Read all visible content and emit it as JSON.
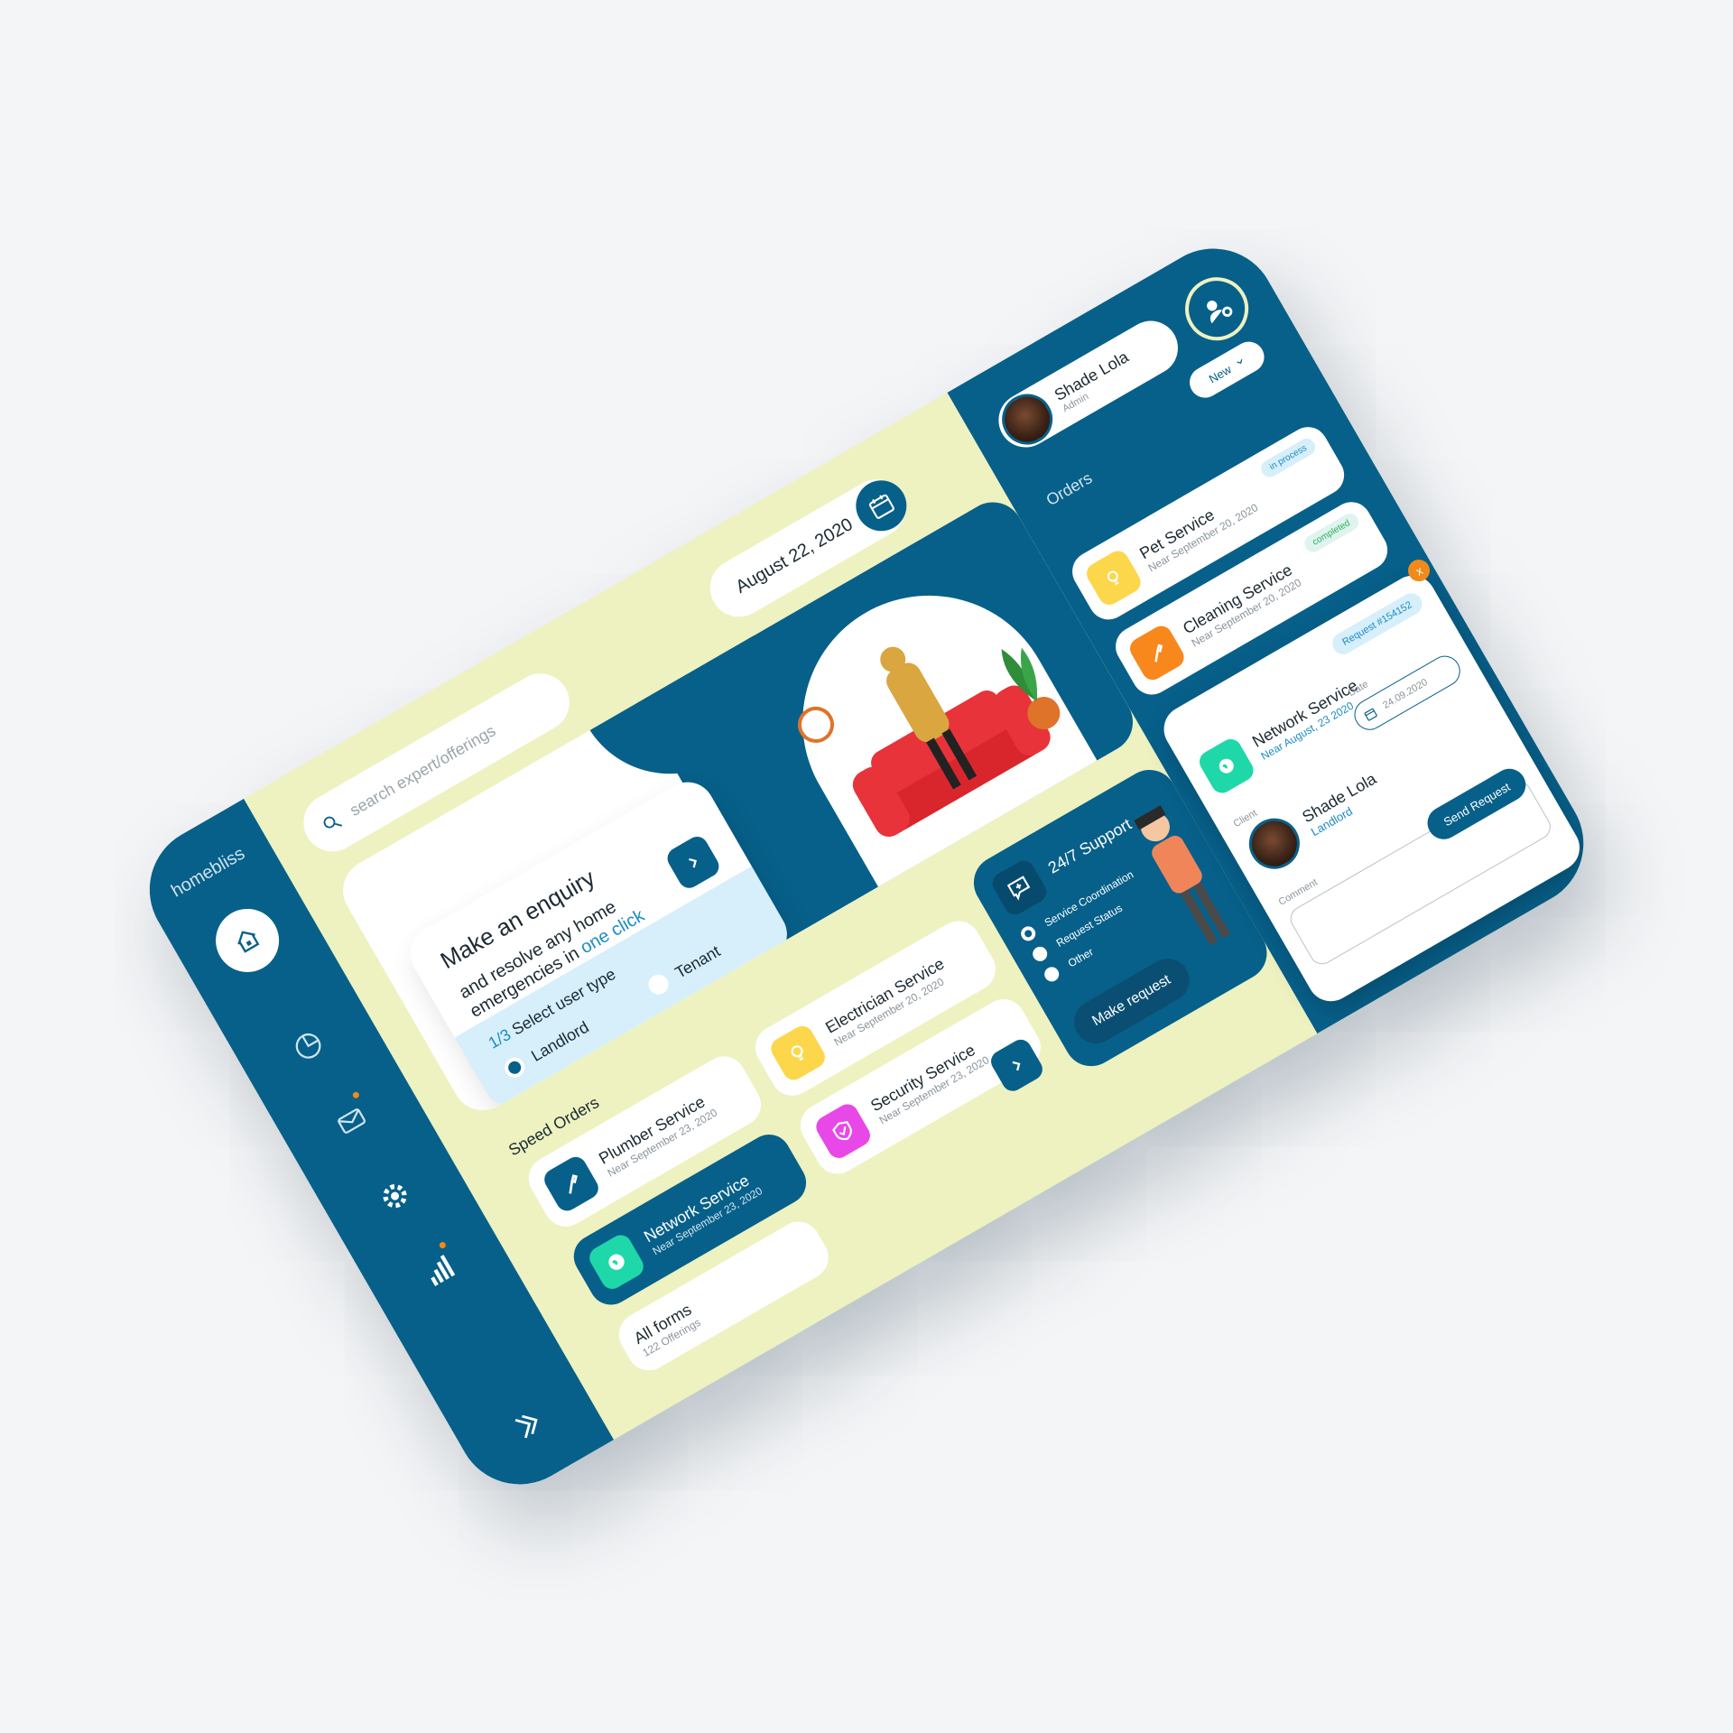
{
  "brand": "homebliss",
  "search": {
    "placeholder": "search expert/offerings"
  },
  "date": "August 22, 2020",
  "enquiry": {
    "title": "Make an enquiry",
    "line1": "and resolve any home",
    "line2_prefix": "emergencies in",
    "line2_highlight": "one click",
    "step_num": "1/3",
    "step_label": "Select user type",
    "options": [
      "Landlord",
      "Tenant"
    ]
  },
  "speed_orders": {
    "title": "Speed Orders",
    "items": [
      {
        "name": "Plumber Service",
        "sub": "Near September 23, 2020",
        "icon": "wrench-icon"
      },
      {
        "name": "Electrician Service",
        "sub": "Near September 20, 2020",
        "icon": "lightbulb-icon"
      },
      {
        "name": "Network Service",
        "sub": "Near September 23, 2020",
        "icon": "globe-icon"
      },
      {
        "name": "Security Service",
        "sub": "Near September 23, 2020",
        "icon": "shield-icon"
      }
    ],
    "all_forms": {
      "title": "All forms",
      "sub": "122 Offerings"
    }
  },
  "support": {
    "title": "24/7 Support",
    "options": [
      "Service Coordination",
      "Request Status",
      "Other"
    ],
    "button": "Make request"
  },
  "profile": {
    "name": "Shade Lola",
    "role": "Admin"
  },
  "orders": {
    "title": "Orders",
    "filter": "New",
    "items": [
      {
        "name": "Pet Service",
        "sub": "Near September 20, 2020",
        "status": "in process",
        "icon": "lightbulb-icon"
      },
      {
        "name": "Cleaning Service",
        "sub": "Near September 20, 2020",
        "status": "completed",
        "icon": "wrench-icon"
      }
    ]
  },
  "request": {
    "number": "Request #154152",
    "name": "Network Service",
    "sub": "Near August, 23 2020",
    "date_label": "Date",
    "date_value": "24.09.2020",
    "client_label": "Client",
    "client_name": "Shade Lola",
    "client_role": "Landlord",
    "comment_label": "Comment",
    "send": "Send Request",
    "close": "x"
  },
  "colors": {
    "navy": "#07608a",
    "cream": "#eef2c0",
    "light_blue": "#d6effa",
    "accent_orange": "#f28a1a"
  }
}
